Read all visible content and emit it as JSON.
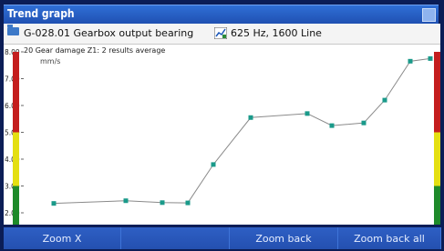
{
  "window": {
    "title": "Trend graph"
  },
  "header": {
    "machine": "G-028.01 Gearbox output bearing",
    "measurement": "625 Hz, 1600 Line"
  },
  "plot": {
    "annotation": "20 Gear damage Z1: 2 results average",
    "unit": "mm/s",
    "y_ticks": [
      "8.00",
      "7.00",
      "6.00",
      "5.00",
      "4.00",
      "3.00",
      "2.00"
    ],
    "alarm_colors": {
      "red": "#c41e1e",
      "yellow": "#e4df12",
      "green": "#1e8a2a"
    }
  },
  "chart_data": {
    "type": "line",
    "ylabel": "mm/s",
    "ylim": [
      2.0,
      8.0
    ],
    "series": [
      {
        "values": [
          2.35,
          2.45,
          2.38,
          2.37,
          3.8,
          5.55,
          5.7,
          5.25,
          5.35,
          6.2,
          7.65,
          7.75
        ]
      }
    ]
  },
  "toolbar": {
    "buttons": [
      "Zoom X",
      "",
      "Zoom back",
      "Zoom back all"
    ]
  }
}
